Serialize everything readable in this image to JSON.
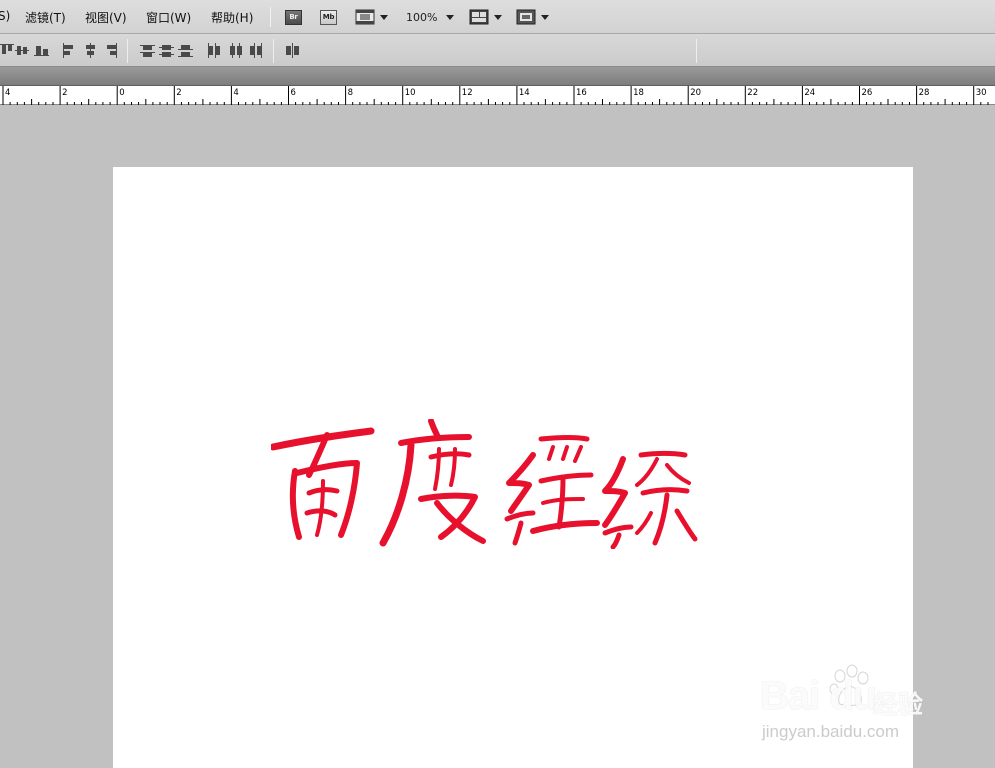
{
  "menu": {
    "items": [
      {
        "label": "S)"
      },
      {
        "label": "滤镜(T)"
      },
      {
        "label": "视图(V)"
      },
      {
        "label": "窗口(W)"
      },
      {
        "label": "帮助(H)"
      }
    ]
  },
  "toolbar": {
    "bridge_label": "Br",
    "minibridge_label": "Mb",
    "zoom_value": "100%"
  },
  "ruler": {
    "tick_labels": [
      "4",
      "2",
      "0",
      "2",
      "4",
      "6",
      "8",
      "10",
      "12",
      "14",
      "16",
      "18",
      "20",
      "22",
      "24",
      "26",
      "28",
      "30"
    ]
  },
  "artwork": {
    "color": "#e8112d"
  },
  "watermark": {
    "brand": "Bai du",
    "sub": "经验",
    "url": "jingyan.baidu.com"
  }
}
